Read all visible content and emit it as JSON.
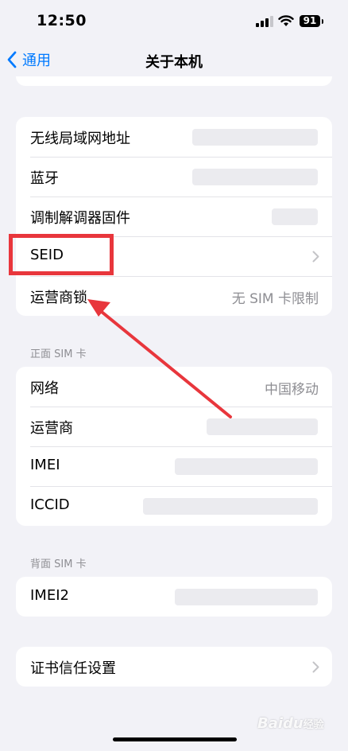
{
  "status_bar": {
    "time": "12:50",
    "battery": "91"
  },
  "nav": {
    "back_label": "通用",
    "title": "关于本机"
  },
  "group1": {
    "rows": [
      {
        "label": "无线局域网地址",
        "value": ""
      },
      {
        "label": "蓝牙",
        "value": ""
      },
      {
        "label": "调制解调器固件",
        "value": ""
      },
      {
        "label": "SEID",
        "value": ""
      },
      {
        "label": "运营商锁",
        "value": "无 SIM 卡限制"
      }
    ]
  },
  "front_sim": {
    "header": "正面 SIM 卡",
    "rows": [
      {
        "label": "网络",
        "value": "中国移动"
      },
      {
        "label": "运营商",
        "value": ""
      },
      {
        "label": "IMEI",
        "value": ""
      },
      {
        "label": "ICCID",
        "value": ""
      }
    ]
  },
  "back_sim": {
    "header": "背面 SIM 卡",
    "rows": [
      {
        "label": "IMEI2",
        "value": ""
      }
    ]
  },
  "trust": {
    "label": "证书信任设置"
  },
  "watermark": {
    "text": "Baidu",
    "suffix": "经验"
  },
  "colors": {
    "accent": "#007aff",
    "annotation": "#e8363c",
    "background": "#f2f2f7"
  }
}
